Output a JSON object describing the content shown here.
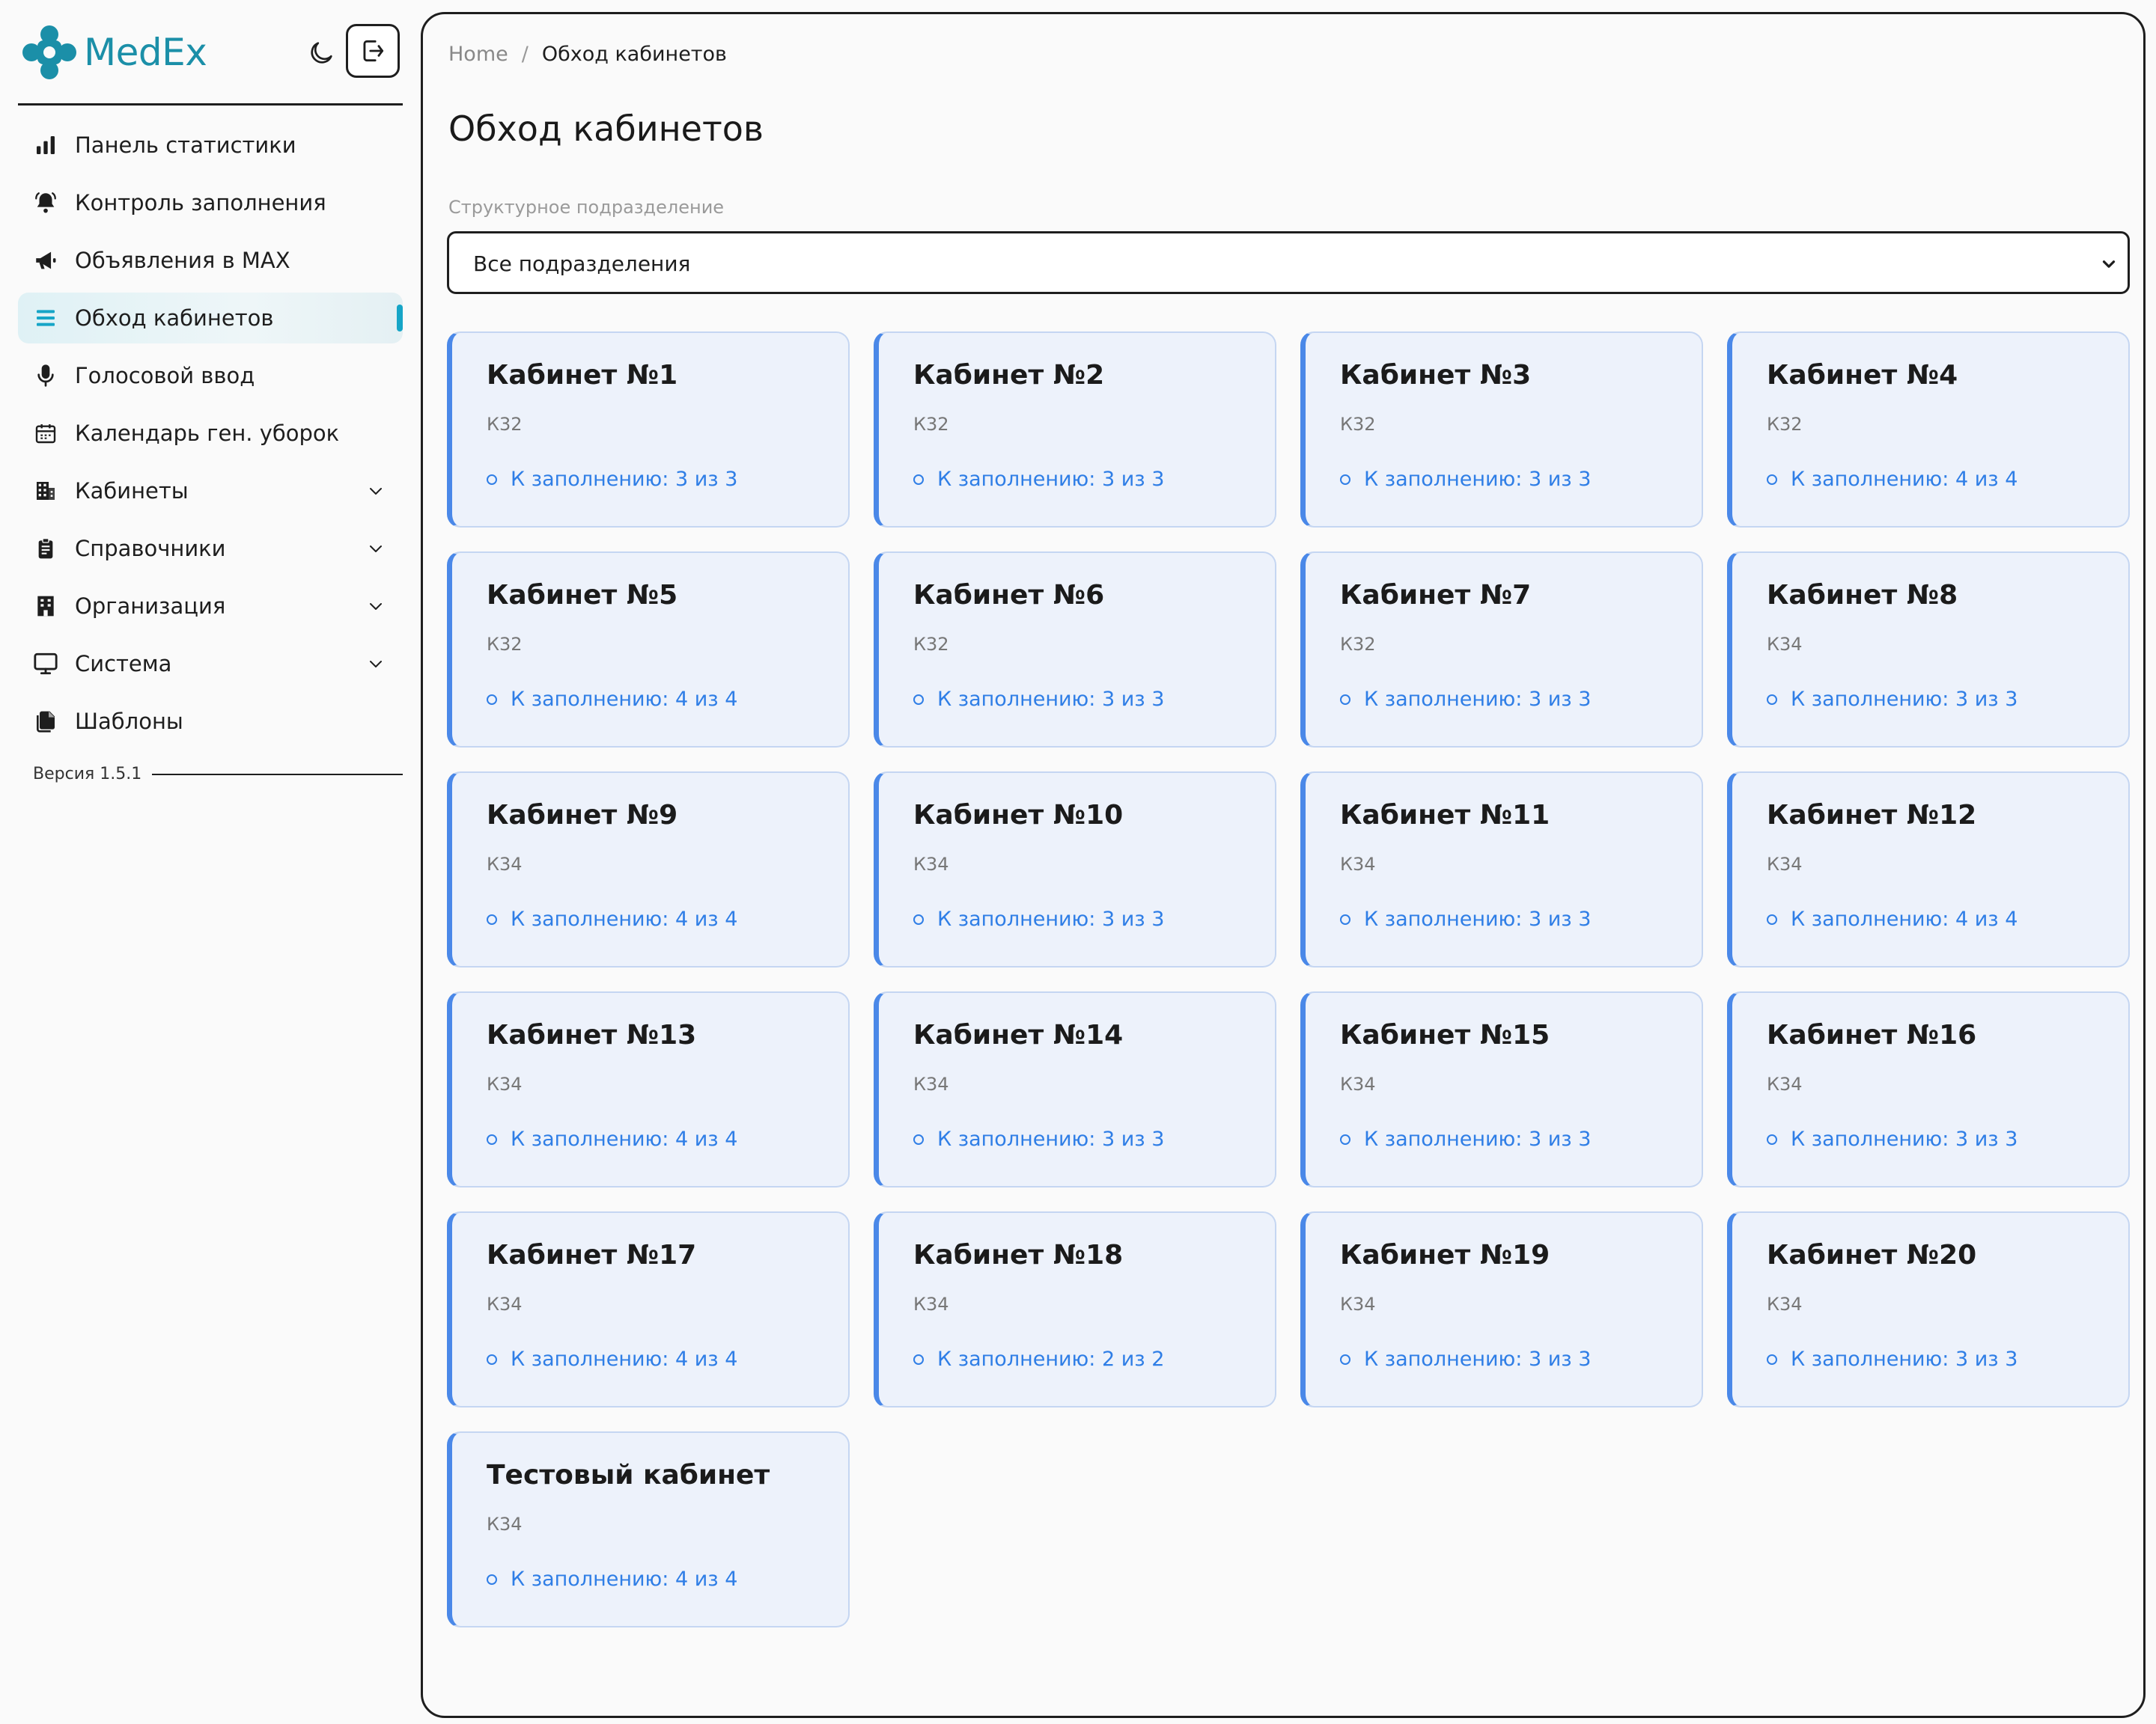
{
  "app": {
    "name": "MedEx"
  },
  "sidebar": {
    "items": [
      {
        "label": "Панель статистики",
        "icon": "bar-chart-icon",
        "active": false,
        "expandable": false
      },
      {
        "label": "Контроль заполнения",
        "icon": "bell-icon",
        "active": false,
        "expandable": false
      },
      {
        "label": "Объявления в MAX",
        "icon": "megaphone-icon",
        "active": false,
        "expandable": false
      },
      {
        "label": "Обход кабинетов",
        "icon": "list-icon",
        "active": true,
        "expandable": false
      },
      {
        "label": "Голосовой ввод",
        "icon": "microphone-icon",
        "active": false,
        "expandable": false
      },
      {
        "label": "Календарь ген. уборок",
        "icon": "calendar-icon",
        "active": false,
        "expandable": false
      },
      {
        "label": "Кабинеты",
        "icon": "building-icon",
        "active": false,
        "expandable": true
      },
      {
        "label": "Справочники",
        "icon": "clipboard-icon",
        "active": false,
        "expandable": true
      },
      {
        "label": "Организация",
        "icon": "office-icon",
        "active": false,
        "expandable": true
      },
      {
        "label": "Система",
        "icon": "monitor-icon",
        "active": false,
        "expandable": true
      },
      {
        "label": "Шаблоны",
        "icon": "documents-icon",
        "active": false,
        "expandable": false
      }
    ],
    "version": "Версия 1.5.1"
  },
  "main": {
    "breadcrumb": {
      "home": "Home",
      "separator": "/",
      "current": "Обход кабинетов"
    },
    "title": "Обход кабинетов",
    "filter": {
      "label": "Структурное подразделение",
      "value": "Все подразделения"
    },
    "cards": [
      {
        "title": "Кабинет №1",
        "code": "К32",
        "status": "К заполнению: 3 из 3"
      },
      {
        "title": "Кабинет №2",
        "code": "К32",
        "status": "К заполнению: 3 из 3"
      },
      {
        "title": "Кабинет №3",
        "code": "К32",
        "status": "К заполнению: 3 из 3"
      },
      {
        "title": "Кабинет №4",
        "code": "К32",
        "status": "К заполнению: 4 из 4"
      },
      {
        "title": "Кабинет №5",
        "code": "К32",
        "status": "К заполнению: 4 из 4"
      },
      {
        "title": "Кабинет №6",
        "code": "К32",
        "status": "К заполнению: 3 из 3"
      },
      {
        "title": "Кабинет №7",
        "code": "К32",
        "status": "К заполнению: 3 из 3"
      },
      {
        "title": "Кабинет №8",
        "code": "К34",
        "status": "К заполнению: 3 из 3"
      },
      {
        "title": "Кабинет №9",
        "code": "К34",
        "status": "К заполнению: 4 из 4"
      },
      {
        "title": "Кабинет №10",
        "code": "К34",
        "status": "К заполнению: 3 из 3"
      },
      {
        "title": "Кабинет №11",
        "code": "К34",
        "status": "К заполнению: 3 из 3"
      },
      {
        "title": "Кабинет №12",
        "code": "К34",
        "status": "К заполнению: 4 из 4"
      },
      {
        "title": "Кабинет №13",
        "code": "К34",
        "status": "К заполнению: 4 из 4"
      },
      {
        "title": "Кабинет №14",
        "code": "К34",
        "status": "К заполнению: 3 из 3"
      },
      {
        "title": "Кабинет №15",
        "code": "К34",
        "status": "К заполнению: 3 из 3"
      },
      {
        "title": "Кабинет №16",
        "code": "К34",
        "status": "К заполнению: 3 из 3"
      },
      {
        "title": "Кабинет №17",
        "code": "К34",
        "status": "К заполнению: 4 из 4"
      },
      {
        "title": "Кабинет №18",
        "code": "К34",
        "status": "К заполнению: 2 из 2"
      },
      {
        "title": "Кабинет №19",
        "code": "К34",
        "status": "К заполнению: 3 из 3"
      },
      {
        "title": "Кабинет №20",
        "code": "К34",
        "status": "К заполнению: 3 из 3"
      },
      {
        "title": "Тестовый кабинет",
        "code": "К34",
        "status": "К заполнению: 4 из 4"
      }
    ]
  },
  "colors": {
    "brand": "#1b8fa8",
    "accent": "#16a5c7",
    "card_bg": "#edf2fb",
    "card_border": "#4a88e8",
    "status": "#2f7ee6"
  }
}
